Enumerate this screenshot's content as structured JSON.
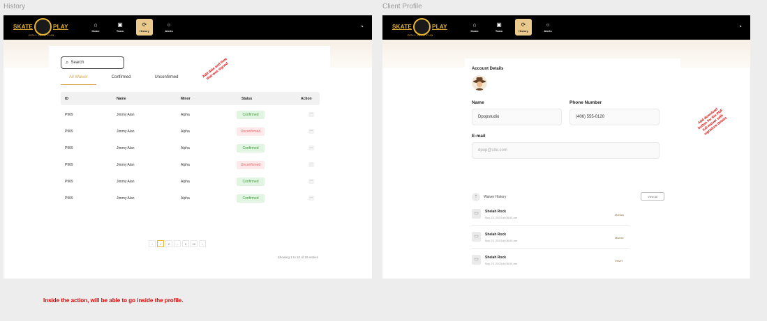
{
  "frames": {
    "history_label": "History",
    "profile_label": "Client Profile"
  },
  "brand": {
    "word_left": "SKATE",
    "word_right": "PLAY",
    "tagline": "ROLL INTO FUN"
  },
  "nav": {
    "items": [
      {
        "label": "Home",
        "icon": "home-icon"
      },
      {
        "label": "Team",
        "icon": "team-icon"
      },
      {
        "label": "History",
        "icon": "history-icon"
      },
      {
        "label": "Alerts",
        "icon": "alerts-icon"
      }
    ],
    "active": "History"
  },
  "history": {
    "search_placeholder": "Search",
    "tabs": [
      "All Waiver",
      "Confirmed",
      "Unconfirmed"
    ],
    "active_tab": "All Waiver",
    "annotation": [
      "Add date and time",
      "that was signed"
    ],
    "columns": [
      "ID",
      "Name",
      "Minor",
      "Status",
      "Action"
    ],
    "rows": [
      {
        "id": "P909",
        "name": "Jimmy Alan",
        "minor": "Alpha",
        "status": "Confirmed"
      },
      {
        "id": "P909",
        "name": "Jimmy Alan",
        "minor": "Alpha",
        "status": "Unconfirmed"
      },
      {
        "id": "P909",
        "name": "Jimmy Alan",
        "minor": "Alpha",
        "status": "Confirmed"
      },
      {
        "id": "P909",
        "name": "Jimmy Alan",
        "minor": "Alpha",
        "status": "Unconfirmed"
      },
      {
        "id": "P909",
        "name": "Jimmy Alan",
        "minor": "Alpha",
        "status": "Confirmed"
      },
      {
        "id": "P909",
        "name": "Jimmy Alan",
        "minor": "Alpha",
        "status": "Confirmed"
      }
    ],
    "action_label": "···",
    "pagination": {
      "prev": "‹",
      "pages": [
        "1",
        "2",
        "...",
        "9",
        "10"
      ],
      "next": "›",
      "active": "1"
    },
    "showing": "Showing 1 to 10 of 10 entries"
  },
  "profile": {
    "section_title": "Account Details",
    "name_label": "Name",
    "name_value": "Dpopstudio",
    "phone_label": "Phone Number",
    "phone_value": "(406) 555-0120",
    "email_label": "E-mail",
    "email_placeholder": "dpop@site.com",
    "annotation": [
      "Add download",
      "button for the PDF",
      "full waiver with",
      "signature details"
    ],
    "waiver_history_title": "Waiver History",
    "view_all": "View All",
    "history": [
      {
        "name": "Shelah Rock",
        "date": "Nov 23, 2023 at 08.00 am",
        "status": "Markus"
      },
      {
        "name": "Shelah Rock",
        "date": "Nov 23, 2023 at 08.00 am",
        "status": "Michee"
      },
      {
        "name": "Shelah Rock",
        "date": "Nov 23, 2023 at 08.00 am",
        "status": "Velvet"
      }
    ]
  },
  "footer_note": "Inside the action, will be able to go inside the profile.",
  "colors": {
    "accent": "#e8b630",
    "confirmed": "#3f9a3f",
    "unconfirmed": "#e06666",
    "annotation": "#e00000"
  }
}
